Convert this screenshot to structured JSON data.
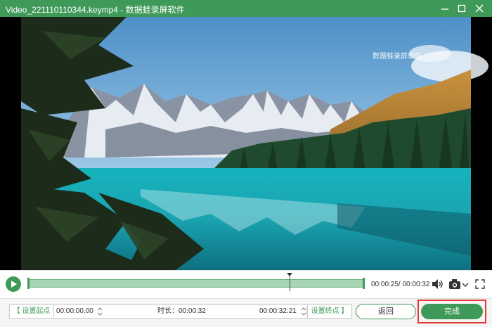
{
  "window": {
    "title": "Video_221110110344.keymp4 - 数据蛙录屏软件",
    "accent_color": "#3f9a5a",
    "controls": [
      "minimize-icon",
      "maximize-icon",
      "close-icon"
    ]
  },
  "video": {
    "watermark": "数据蛙录屏软件"
  },
  "player": {
    "play_icon": "play-icon",
    "progress_fraction": 0.78,
    "current_time": "00:00:25",
    "total_time": "00:00:32",
    "time_display": "00:00:25/ 00:00:32",
    "volume_icon": "speaker-icon",
    "screenshot_icon": "camera-icon",
    "fullscreen_icon": "fullscreen-icon"
  },
  "trim": {
    "set_start_label": "【 设置起点",
    "start_value": "00:00:00.00",
    "duration_label": "时长：00:00:32",
    "end_value": "00:00:32.21",
    "set_end_label": "设置终点 】"
  },
  "actions": {
    "back_label": "返回",
    "done_label": "完成",
    "highlight_color": "#e53935"
  }
}
